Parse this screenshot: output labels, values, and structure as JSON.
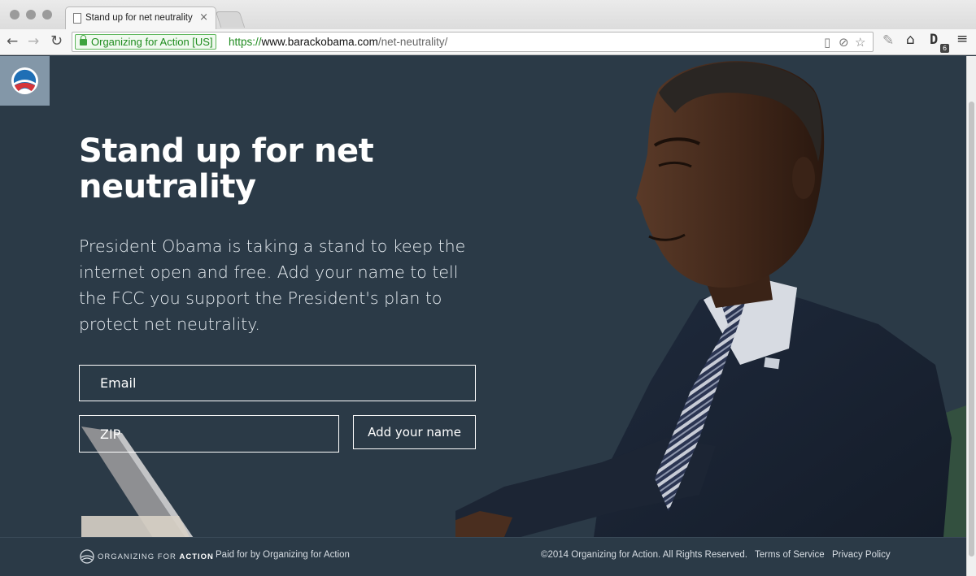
{
  "browser": {
    "tab_title": "Stand up for net neutrality",
    "tab_close": "×",
    "ev_label": "Organizing for Action [US]",
    "url_scheme": "https://",
    "url_host": "www.barackobama.com",
    "url_path": "/net-neutrality/",
    "extension_badge": "6"
  },
  "page": {
    "headline": "Stand up for net neutrality",
    "lede": "President Obama is taking a stand to keep the internet open and free. Add your name to tell the FCC you support the President's plan to protect net neutrality.",
    "email_placeholder": "Email",
    "zip_placeholder": "ZIP",
    "submit_label": "Add your name"
  },
  "footer": {
    "brand_light": "ORGANIZING FOR ",
    "brand_bold": "ACTION",
    "paid_for": "Paid for by Organizing for Action",
    "copyright": "©2014 Organizing for Action. All Rights Reserved.",
    "terms": "Terms of Service",
    "privacy": "Privacy Policy"
  },
  "colors": {
    "page_background": "#2b3a47",
    "logo_box": "#8397a8",
    "ev_green": "#1e8c1e"
  }
}
